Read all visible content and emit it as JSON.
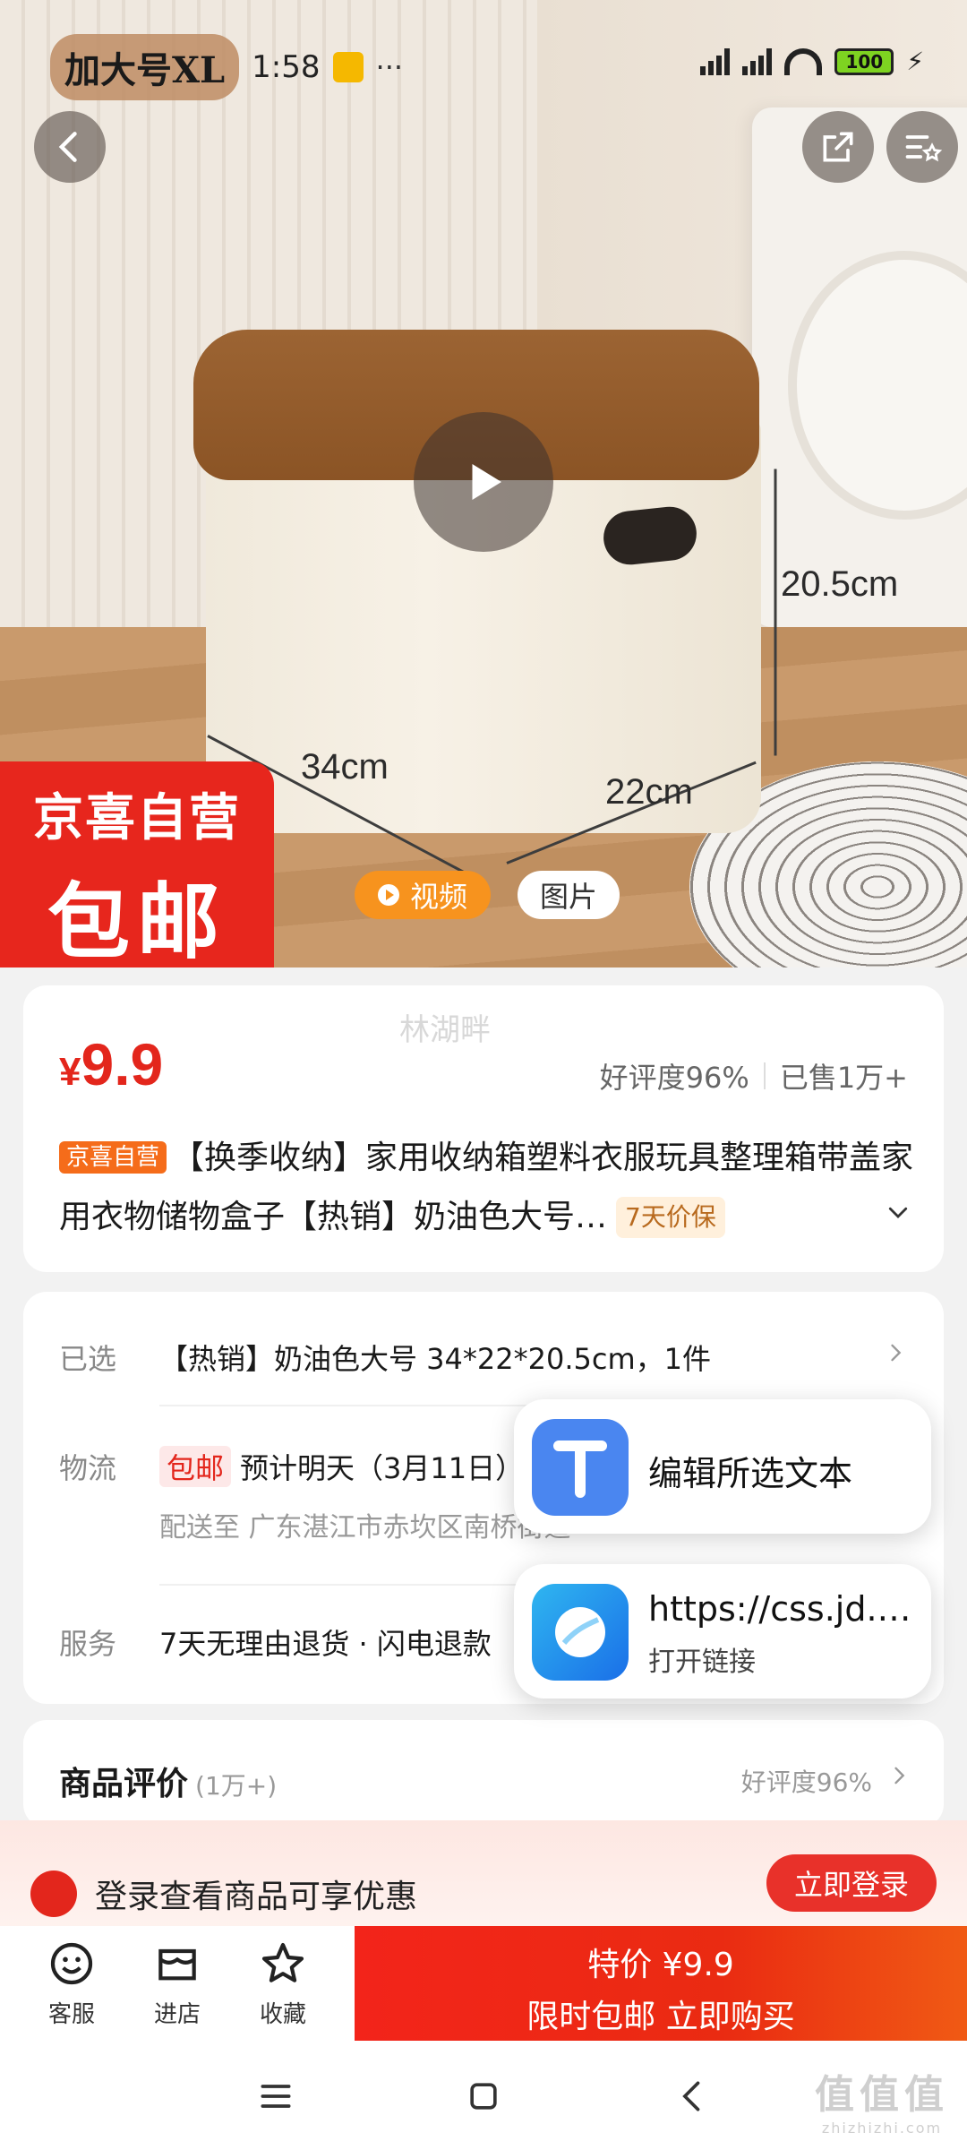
{
  "status_bar": {
    "app_chip": "加大号XL",
    "time": "1:58",
    "more": "···",
    "battery": "100"
  },
  "hero": {
    "dim_length": "34cm",
    "dim_width": "22cm",
    "dim_height": "20.5cm",
    "badge_line1": "京喜自营",
    "badge_line2": "包邮",
    "tab_video": "视频",
    "tab_image": "图片"
  },
  "price_card": {
    "watermark": "林湖畔",
    "currency": "¥",
    "price": "9.9",
    "rating": "好评度96%",
    "sold": "已售1万+",
    "tag_jd": "京喜自营",
    "title": "【换季收纳】家用收纳箱塑料衣服玩具整理箱带盖家用衣物储物盒子【热销】奶油色大号…",
    "tag_7day": "7天价保"
  },
  "details": {
    "selected_label": "已选",
    "selected_value": "【热销】奶油色大号 34*22*20.5cm，1件",
    "logistics_label": "物流",
    "logistics_tag": "包邮",
    "logistics_value": "预计明天（3月11日）",
    "delivery_value": "配送至  广东湛江市赤坎区南桥街道",
    "service_label": "服务",
    "service_value": "7天无理由退货 · 闪电退款"
  },
  "reviews": {
    "title": "商品评价",
    "count": "(1万+)",
    "rating": "好评度96%"
  },
  "popups": {
    "edit_text": "编辑所选文本",
    "link_url": "https://css.jd.com",
    "link_sub": "打开链接"
  },
  "login_banner": {
    "text": "登录查看商品可享优惠",
    "button": "立即登录"
  },
  "action_bar": {
    "service": "客服",
    "store": "进店",
    "favorite": "收藏",
    "buy_line1": "特价 ¥9.9",
    "buy_line2": "限时包邮 立即购买"
  },
  "watermark_site": {
    "line1": "值值值",
    "line2": "zhizhizhi.com"
  },
  "colors": {
    "accent_red": "#e3261c",
    "video_tab": "#f7931e",
    "jd_tag": "#f56c1a"
  }
}
